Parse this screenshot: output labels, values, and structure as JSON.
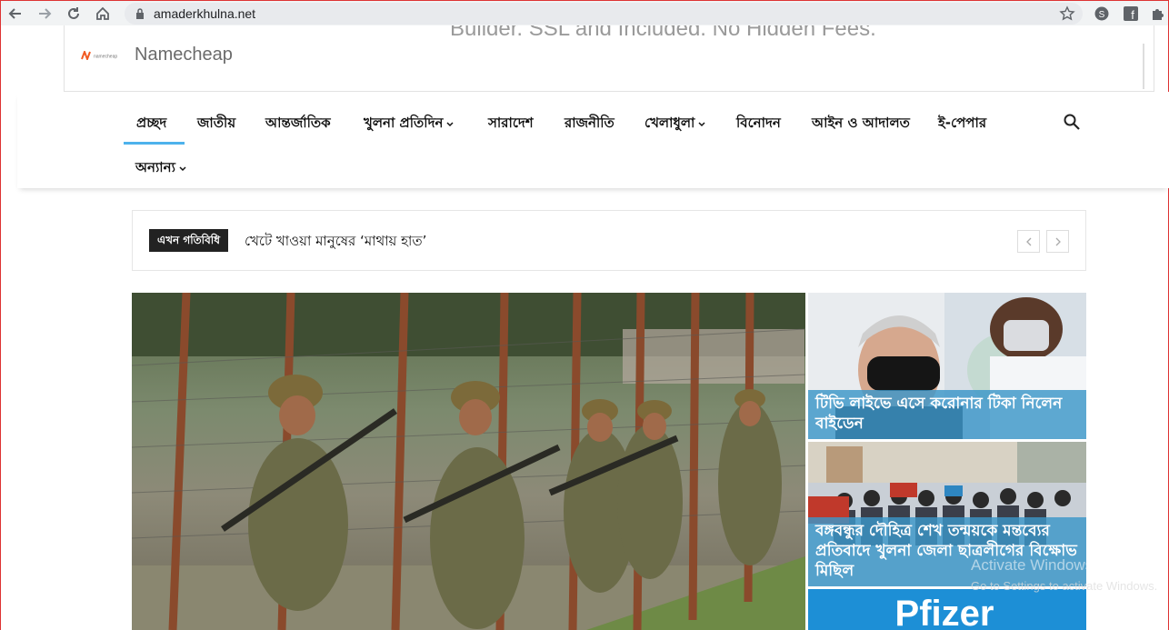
{
  "browser": {
    "url": "amaderkhulna.net"
  },
  "ad": {
    "tagline": "Builder. SSL and Included. No Hidden Fees.",
    "brand": "Namecheap",
    "logo_text": "namecheap"
  },
  "nav": {
    "items": [
      {
        "label": "প্রচ্ছদ",
        "dropdown": false
      },
      {
        "label": "জাতীয়",
        "dropdown": false
      },
      {
        "label": "আন্তর্জাতিক",
        "dropdown": false
      },
      {
        "label": "খুলনা প্রতিদিন",
        "dropdown": true
      },
      {
        "label": "সারাদেশ",
        "dropdown": false
      },
      {
        "label": "রাজনীতি",
        "dropdown": false
      },
      {
        "label": "খেলাধুলা",
        "dropdown": true
      },
      {
        "label": "বিনোদন",
        "dropdown": false
      },
      {
        "label": "আইন ও আদালত",
        "dropdown": false
      },
      {
        "label": "ই-পেপার",
        "dropdown": false
      }
    ],
    "more": {
      "label": "অন্যান্য",
      "dropdown": true
    },
    "accent_color": "#4db2ec"
  },
  "ticker": {
    "tag": "এখন গতিবিধি",
    "headline": "খেটে খাওয়া মানুষের ‘মাথায় হাত’",
    "prev_icon": "chevron-left-icon",
    "next_icon": "chevron-right-icon"
  },
  "featured": {
    "side": [
      {
        "title": "টিভি লাইভে এসে করোনার টিকা নিলেন বাইডেন"
      },
      {
        "title": "বঙ্গবন্ধুর দৌহিত্র শেখ তন্ময়কে মন্তব্যের প্রতিবাদে খুলনা জেলা ছাত্রলীগের বিক্ষোভ মিছিল"
      },
      {
        "title": ""
      }
    ],
    "bottom_image_text": "Pfizer"
  },
  "os_watermark": {
    "title": "Activate Windows",
    "subtitle": "Go to Settings to activate Windows."
  }
}
